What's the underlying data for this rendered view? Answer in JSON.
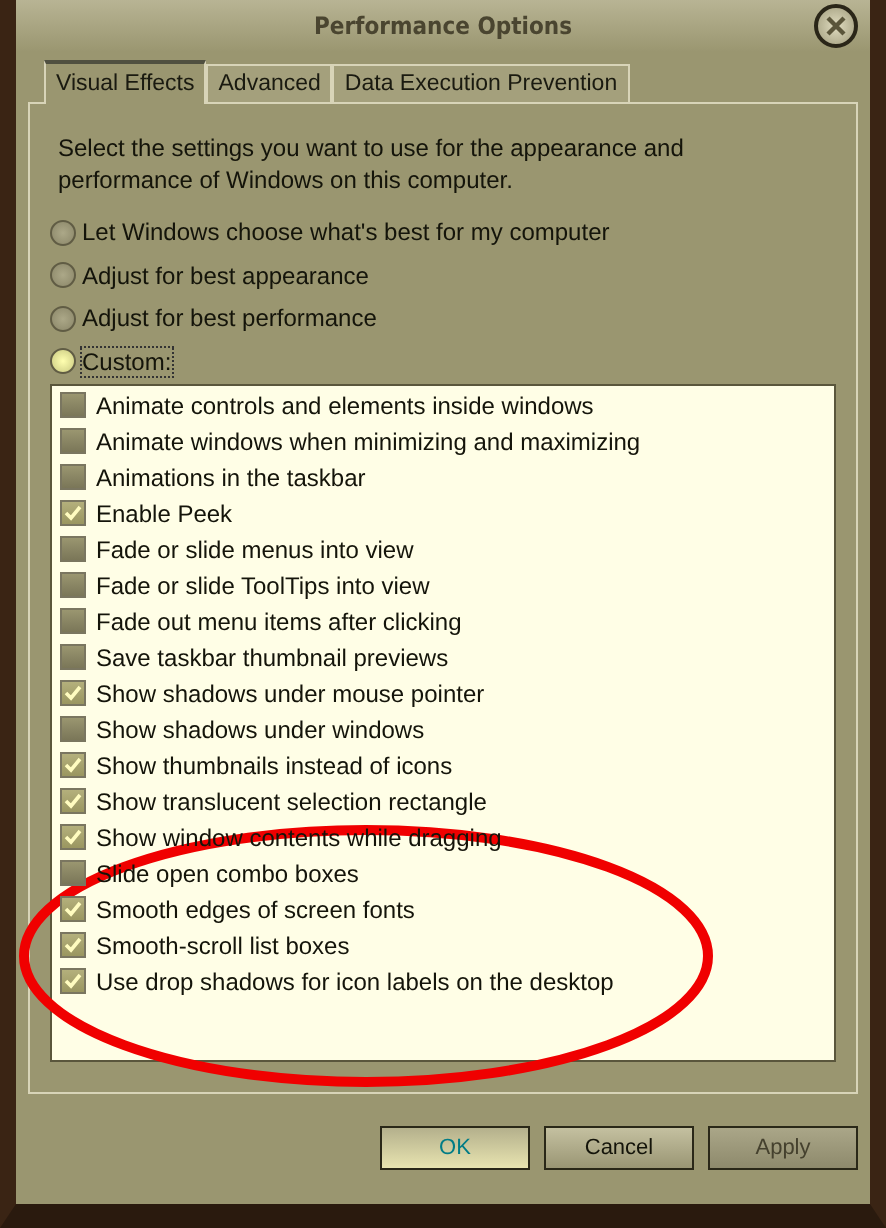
{
  "window": {
    "title": "Performance Options"
  },
  "tabs": [
    {
      "label": "Visual Effects",
      "selected": true
    },
    {
      "label": "Advanced",
      "selected": false
    },
    {
      "label": "Data Execution Prevention",
      "selected": false
    }
  ],
  "description": "Select the settings you want to use for the appearance and performance of Windows on this computer.",
  "options": [
    {
      "label": "Let Windows choose what's best for my computer",
      "selected": false
    },
    {
      "label": "Adjust for best appearance",
      "selected": false
    },
    {
      "label": "Adjust for best performance",
      "selected": false
    },
    {
      "label": "Custom:",
      "selected": true
    }
  ],
  "effects": [
    {
      "label": "Animate controls and elements inside windows",
      "checked": false
    },
    {
      "label": "Animate windows when minimizing and maximizing",
      "checked": false
    },
    {
      "label": "Animations in the taskbar",
      "checked": false
    },
    {
      "label": "Enable Peek",
      "checked": true
    },
    {
      "label": "Fade or slide menus into view",
      "checked": false
    },
    {
      "label": "Fade or slide ToolTips into view",
      "checked": false
    },
    {
      "label": "Fade out menu items after clicking",
      "checked": false
    },
    {
      "label": "Save taskbar thumbnail previews",
      "checked": false
    },
    {
      "label": "Show shadows under mouse pointer",
      "checked": true
    },
    {
      "label": "Show shadows under windows",
      "checked": false
    },
    {
      "label": "Show thumbnails instead of icons",
      "checked": true
    },
    {
      "label": "Show translucent selection rectangle",
      "checked": true
    },
    {
      "label": "Show window contents while dragging",
      "checked": true
    },
    {
      "label": "Slide open combo boxes",
      "checked": false
    },
    {
      "label": "Smooth edges of screen fonts",
      "checked": true
    },
    {
      "label": "Smooth-scroll list boxes",
      "checked": true
    },
    {
      "label": "Use drop shadows for icon labels on the desktop",
      "checked": true
    }
  ],
  "buttons": [
    {
      "label": "OK",
      "kind": "default",
      "disabled": false
    },
    {
      "label": "Cancel",
      "kind": "normal",
      "disabled": false
    },
    {
      "label": "Apply",
      "kind": "normal",
      "disabled": true
    }
  ],
  "annotation": {
    "kind": "ellipse"
  }
}
